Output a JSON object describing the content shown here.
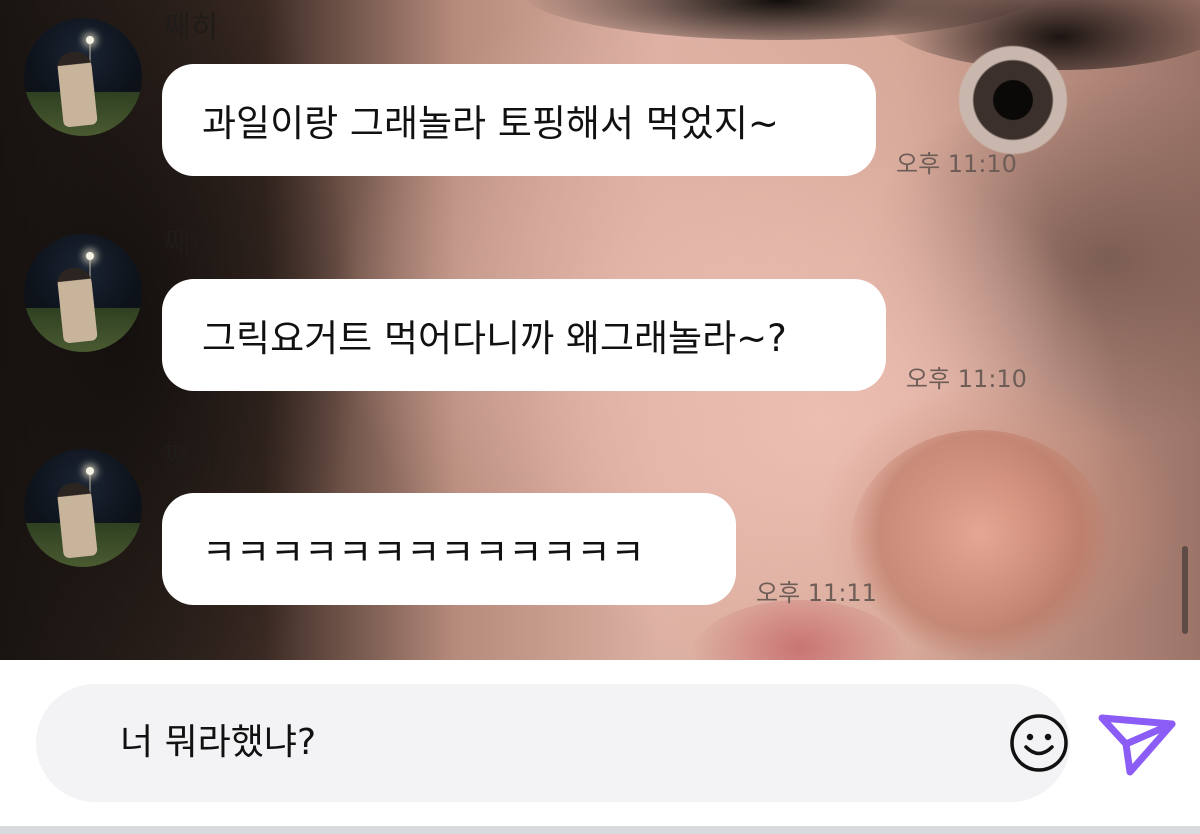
{
  "messages": [
    {
      "sender": "째히",
      "text": "과일이랑 그래놀라 토핑해서 먹었지~",
      "time": "오후 11:10",
      "avatar_icon": "profile-photo-icon"
    },
    {
      "sender": "째히",
      "text": "그릭요거트 먹어다니까 왜그래놀라~?",
      "time": "오후 11:10",
      "avatar_icon": "profile-photo-icon"
    },
    {
      "sender": "째히",
      "text": "ㅋㅋㅋㅋㅋㅋㅋㅋㅋㅋㅋㅋㅋ",
      "time": "오후 11:11",
      "avatar_icon": "profile-photo-icon"
    }
  ],
  "composer": {
    "value": "너 뭐라했냐?",
    "emoji_icon": "smiley-icon",
    "send_icon": "paper-plane-send-icon"
  },
  "colors": {
    "send_accent": "#8b5cf6",
    "bubble": "#ffffff",
    "input_background": "#f3f3f5"
  }
}
